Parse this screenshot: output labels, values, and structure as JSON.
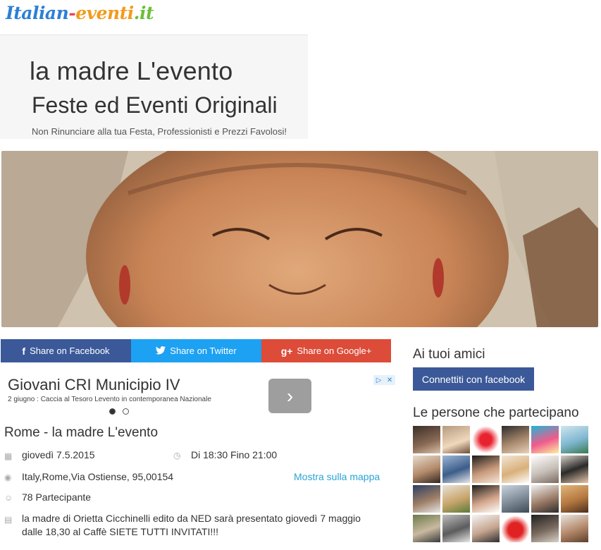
{
  "logo": {
    "part1": "Italian",
    "part2": "-",
    "part3": "eventi",
    "part4": ".it"
  },
  "header": {
    "event_title": "la madre L'evento",
    "site_subtitle": "Feste ed Eventi Originali",
    "tagline": "Non Rinunciare alla tua Festa, Professionisti e Prezzi Favolosi!"
  },
  "share": {
    "facebook": "Share on Facebook",
    "twitter": "Share on Twitter",
    "google": "Share on Google+"
  },
  "ad": {
    "title": "Giovani CRI Municipio IV",
    "subtitle": "2 giugno : Caccia al Tesoro Levento in contemporanea Nazionale"
  },
  "event": {
    "city_title": "Rome - la madre L'evento",
    "date": "giovedì 7.5.2015",
    "time": "Di 18:30 Fino 21:00",
    "address": "Italy,Rome,Via Ostiense, 95,00154",
    "map_link": "Mostra sulla mappa",
    "participants": "78 Partecipante",
    "description_line1": "la madre di Orietta Cicchinelli edito da NED sarà presentato giovedì 7 maggio",
    "description_line2": "dalle 18,30 al Caffè SIETE TUTTI INVITATI!!!"
  },
  "sidebar": {
    "friends_heading": "Ai tuoi amici",
    "connect_button": "Connettiti con facebook",
    "participants_heading": "Le persone che partecipano"
  },
  "colors": {
    "facebook": "#3b5998",
    "twitter": "#1da1f2",
    "google": "#dd4b39",
    "link": "#2aa3d6"
  }
}
